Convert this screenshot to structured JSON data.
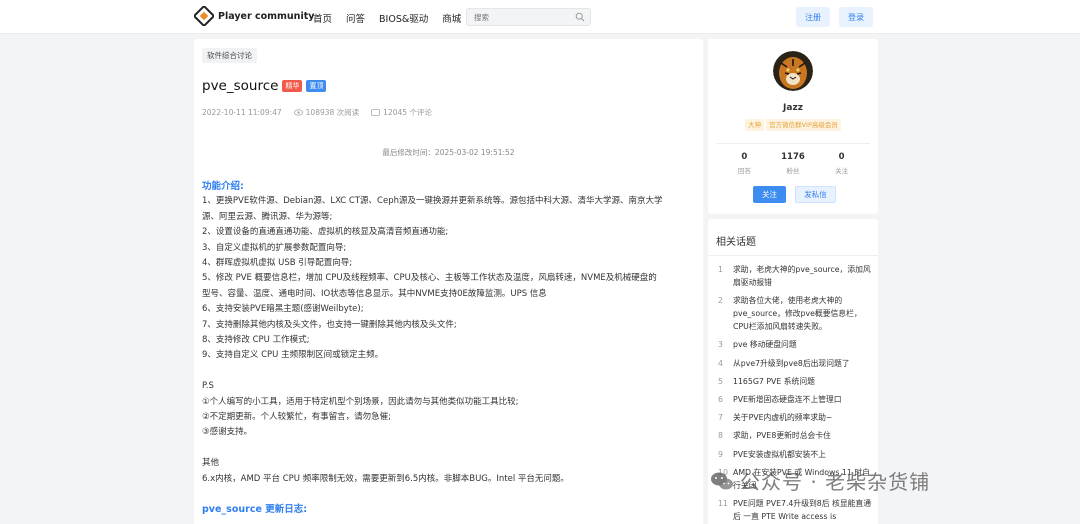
{
  "header": {
    "logo_text": "Player community",
    "nav": [
      "首页",
      "问答",
      "BIOS&驱动",
      "商城"
    ],
    "search_placeholder": "搜索",
    "register_label": "注册",
    "login_label": "登录"
  },
  "post": {
    "category": "软件综合讨论",
    "title": "pve_source",
    "badge_featured": "精华",
    "badge_pinned": "置顶",
    "date": "2022-10-11 11:09:47",
    "views": "108938 次阅读",
    "comments": "12045 个评论",
    "modified": "最后修改时间：2025-03-02 19:51:52",
    "content": {
      "heading1": "功能介绍:",
      "line1a": "1、更换PVE软件源、Debian源、LXC CT源、Ceph源及一键换源并更新系统等。源包括中科大源、清华大学源、南京大学",
      "line1b": "源、阿里云源、腾讯源、华为源等;",
      "line2": "2、设置设备的直通直通功能、虚拟机的核显及高清音频直通功能;",
      "line3": "3、自定义虚拟机的扩展参数配置向导;",
      "line4": "4、群晖虚拟机虚拟 USB 引导配置向导;",
      "line5a": "5、修改 PVE 概要信息栏，增加 CPU及线程频率、CPU及核心、主板等工作状态及温度，风扇转速，NVME及机械硬盘的",
      "line5b": "型号、容量、温度、通电时间、IO状态等信息显示。其中NVME支持0E故障监测。UPS 信息",
      "line6": "6、支持安装PVE暗黑主题(感谢Weilbyte);",
      "line7": "7、支持删除其他内核及头文件，也支持一键删除其他内核及头文件;",
      "line8": "8、支持修改 CPU 工作模式;",
      "line9": "9、支持自定义 CPU 主频限制区间或锁定主频。",
      "ps_title": "P.S",
      "ps1": "①个人编写的小工具，适用于特定机型个别场景，因此请勿与其他类似功能工具比较;",
      "ps2": "②不定期更新。个人较繁忙，有事留言，请勿急催;",
      "ps3": "③感谢支持。",
      "other_title": "其他",
      "other1": "6.x内核，AMD 平台 CPU 频率限制无效，需要更新到6.5内核。非脚本BUG。Intel 平台无问题。",
      "heading2": "pve_source 更新日志:"
    }
  },
  "profile": {
    "name": "Jazz",
    "tag1": "大神",
    "tag2": "官方微信群VIP高级会员",
    "stats": [
      {
        "num": "0",
        "label": "回答"
      },
      {
        "num": "1176",
        "label": "粉丝"
      },
      {
        "num": "0",
        "label": "关注"
      }
    ],
    "follow_label": "关注",
    "pm_label": "发私信"
  },
  "related": {
    "title": "相关话题",
    "items": [
      {
        "n": "1",
        "text": "求助，老虎大神的pve_source，添加风扇驱动报错"
      },
      {
        "n": "2",
        "text": "求助各位大佬，使用老虎大神的pve_source，修改pve概要信息栏，CPU栏添加风扇转速失败。"
      },
      {
        "n": "3",
        "text": "pve 移动硬盘问题"
      },
      {
        "n": "4",
        "text": "从pve7升级到pve8后出现问题了"
      },
      {
        "n": "5",
        "text": "1165G7 PVE 系统问题"
      },
      {
        "n": "6",
        "text": "PVE新增固态硬盘连不上管理口"
      },
      {
        "n": "7",
        "text": "关于PVE内虚机的频率求助~"
      },
      {
        "n": "8",
        "text": "求助，PVE8更新时总会卡住"
      },
      {
        "n": "9",
        "text": "PVE安装虚拟机都安装不上"
      },
      {
        "n": "10",
        "text": "AMD 在安装PVE 或 Windows 11 时自行关闭"
      },
      {
        "n": "11",
        "text": "PVE问题 PVE7.4升级到8后 核显能直通后 一直 PTE Write access is"
      }
    ]
  },
  "watermark": "公众号 · 老柴杂货铺",
  "colors": {
    "accent": "#2f7ef0",
    "featured": "#f15a4a",
    "pinned": "#3d8cf0",
    "tag": "#e5a23c"
  }
}
